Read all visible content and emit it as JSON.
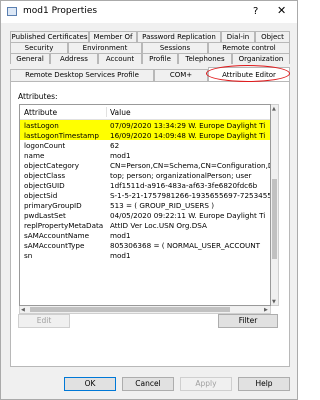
{
  "window": {
    "title": "mod1 Properties",
    "help_glyph": "?",
    "close_glyph": "✕",
    "app_icon": "window-icon"
  },
  "tabs": {
    "row1": [
      "Published Certificates",
      "Member Of",
      "Password Replication",
      "Dial-in",
      "Object"
    ],
    "row2": [
      "Security",
      "Environment",
      "Sessions",
      "Remote control"
    ],
    "row3": [
      "General",
      "Address",
      "Account",
      "Profile",
      "Telephones",
      "Organization"
    ],
    "row4": [
      "Remote Desktop Services Profile",
      "COM+",
      "Attribute Editor"
    ],
    "active": "Attribute Editor"
  },
  "attributes": {
    "label": "Attributes:",
    "columns": [
      "Attribute",
      "Value"
    ],
    "rows": [
      {
        "name": "lastLogon",
        "value": "07/09/2020 13:34:29 W. Europe Daylight Ti",
        "highlighted": true
      },
      {
        "name": "lastLogonTimestamp",
        "value": "16/09/2020 14:09:48 W. Europe Daylight Ti",
        "highlighted": true
      },
      {
        "name": "logonCount",
        "value": "62"
      },
      {
        "name": "name",
        "value": "mod1"
      },
      {
        "name": "objectCategory",
        "value": "CN=Person,CN=Schema,CN=Configuration,D"
      },
      {
        "name": "objectClass",
        "value": "top; person; organizationalPerson; user"
      },
      {
        "name": "objectGUID",
        "value": "1df1511d-a916-483a-af63-3fe6820fdc6b"
      },
      {
        "name": "objectSid",
        "value": "S-1-5-21-1757981266-1935655697-7253455"
      },
      {
        "name": "primaryGroupID",
        "value": "513 = ( GROUP_RID_USERS )"
      },
      {
        "name": "pwdLastSet",
        "value": "04/05/2020 09:22:11 W. Europe Daylight Ti"
      },
      {
        "name": "replPropertyMetaData",
        "value": "AttID  Ver   Loc.USN          Org.DSA"
      },
      {
        "name": "sAMAccountName",
        "value": "mod1"
      },
      {
        "name": "sAMAccountType",
        "value": "805306368 = ( NORMAL_USER_ACCOUNT"
      },
      {
        "name": "sn",
        "value": "mod1"
      }
    ],
    "highlight_color": "#ffff00"
  },
  "buttons": {
    "edit": "Edit",
    "filter": "Filter",
    "ok": "OK",
    "cancel": "Cancel",
    "apply": "Apply",
    "help": "Help"
  },
  "annotation": {
    "ring_color": "#e0191b"
  }
}
